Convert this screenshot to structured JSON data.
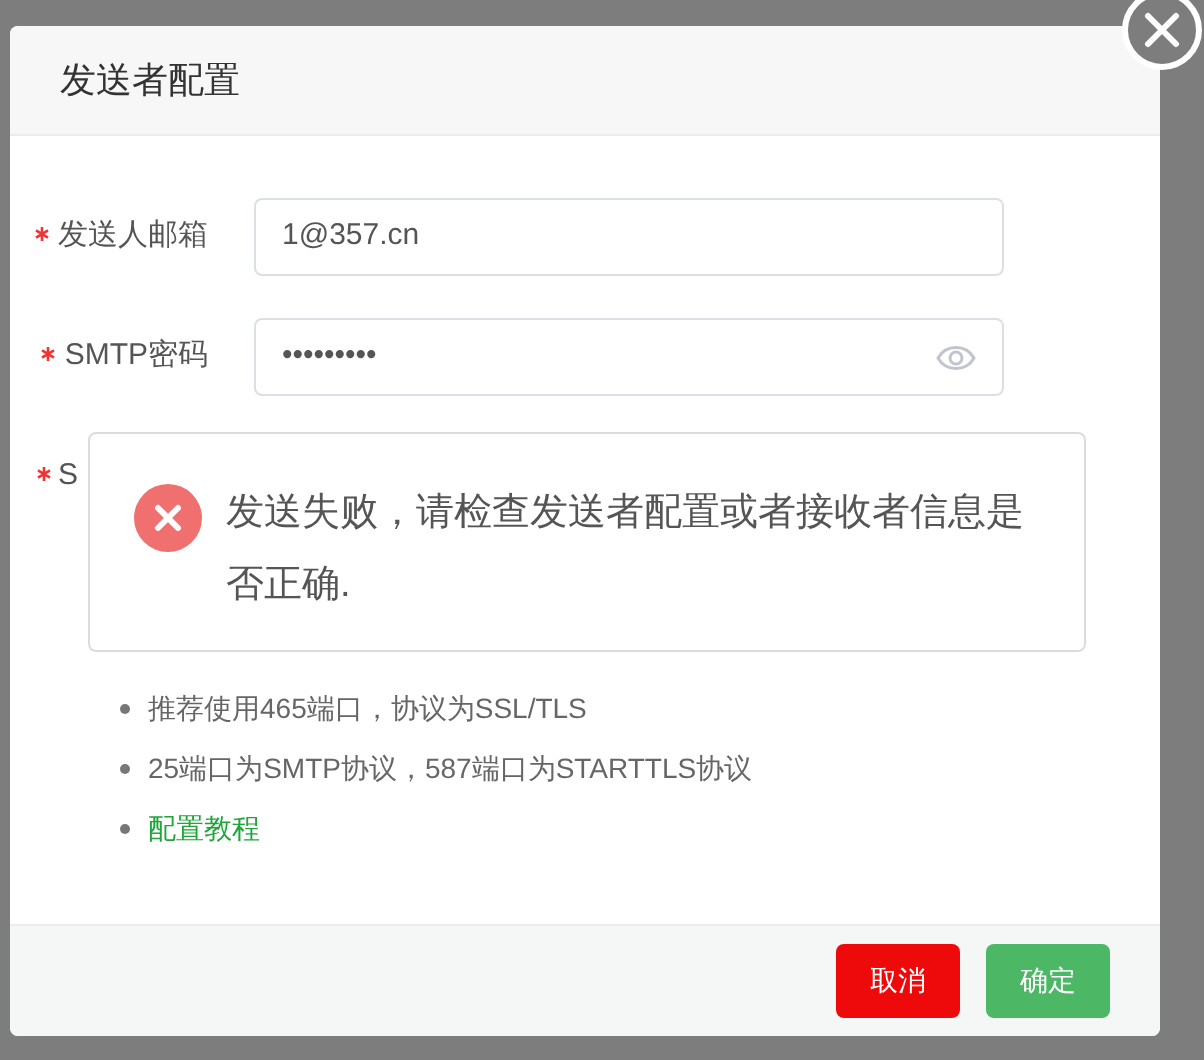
{
  "dialog": {
    "title": "发送者配置",
    "fields": [
      {
        "label": "发送人邮箱",
        "required": true,
        "value": "1@357.cn",
        "kind": "text"
      },
      {
        "label": "SMTP密码",
        "required": true,
        "value": "•••••••••",
        "kind": "password"
      },
      {
        "label": "S",
        "required": true,
        "kind": "hidden"
      }
    ],
    "alert": {
      "message": "发送失败，请检查发送者配置或者接收者信息是否正确."
    },
    "tips": [
      {
        "text": "推荐使用465端口，协议为SSL/TLS",
        "kind": "text"
      },
      {
        "text": "25端口为SMTP协议，587端口为STARTTLS协议",
        "kind": "text"
      },
      {
        "text": "配置教程",
        "kind": "link"
      }
    ],
    "buttons": [
      {
        "label": "取消",
        "kind": "cancel"
      },
      {
        "label": "确定",
        "kind": "confirm"
      }
    ]
  }
}
